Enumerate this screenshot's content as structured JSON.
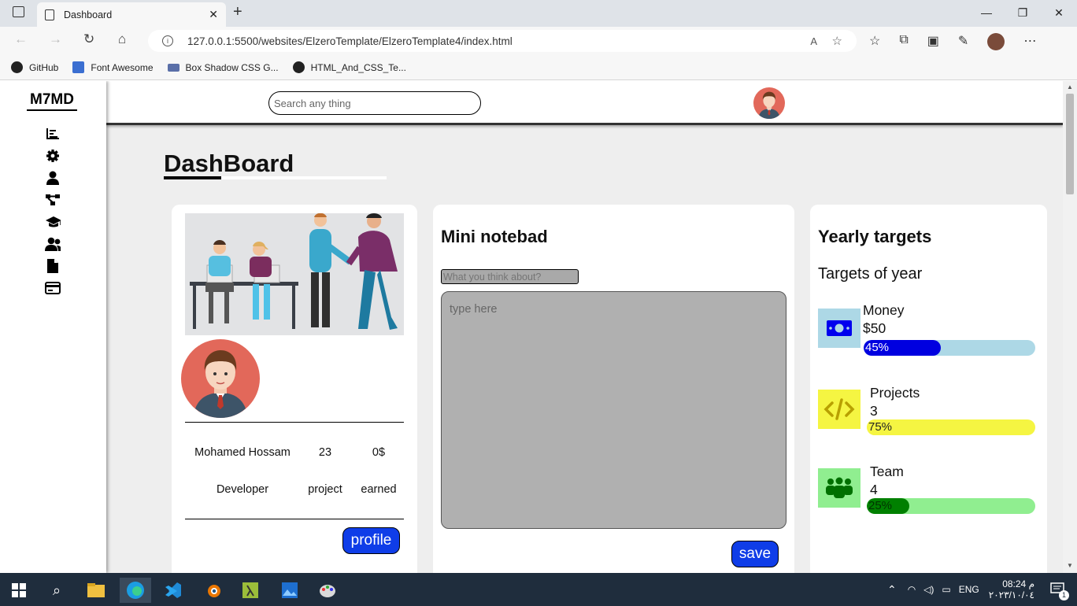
{
  "browser": {
    "tab_title": "Dashboard",
    "url": "127.0.0.1:5500/websites/ElzeroTemplate/ElzeroTemplate4/index.html",
    "bookmarks": [
      {
        "label": "GitHub",
        "color": "#222"
      },
      {
        "label": "Font Awesome",
        "color": "#3b6fd1"
      },
      {
        "label": "Box Shadow CSS G...",
        "color": "#5a6fa8"
      },
      {
        "label": "HTML_And_CSS_Te...",
        "color": "#222"
      }
    ]
  },
  "sidebar": {
    "logo": "M7MD",
    "icons": [
      "chart-icon",
      "gear-icon",
      "user-icon",
      "diagram-icon",
      "graduation-cap-icon",
      "users-icon",
      "file-icon",
      "credit-card-icon"
    ]
  },
  "header": {
    "search_placeholder": "Search any thing"
  },
  "main": {
    "title": "DashBoard"
  },
  "profile_card": {
    "name": "Mohamed Hossam",
    "role": "Developer",
    "projects_count": "23",
    "projects_label": "project",
    "earned_value": "0$",
    "earned_label": "earned",
    "button": "profile"
  },
  "notepad": {
    "title": "Mini notebad",
    "input_placeholder": "What you think about?",
    "textarea_placeholder": "type here",
    "button": "save"
  },
  "targets": {
    "title": "Yearly targets",
    "subtitle": "Targets of year",
    "items": [
      {
        "name": "Money",
        "value": "$50",
        "percent_label": "45%",
        "percent": 45,
        "icon": "money-icon",
        "icon_bg": "#add8e6",
        "icon_color": "#0000ee",
        "track": "#add8e6",
        "fill": "#0000e0",
        "text": "#ffffff"
      },
      {
        "name": "Projects",
        "value": "3",
        "percent_label": "75%",
        "percent": 75,
        "icon": "code-icon",
        "icon_bg": "#f5f542",
        "icon_color": "#b8a000",
        "track": "#f5f542",
        "fill": "#f5f542",
        "text": "#222222"
      },
      {
        "name": "Team",
        "value": "4",
        "percent_label": "25%",
        "percent": 25,
        "icon": "team-icon",
        "icon_bg": "#90ee90",
        "icon_color": "#007000",
        "track": "#90ee90",
        "fill": "#008000",
        "text": "#003300"
      }
    ]
  },
  "system": {
    "language": "ENG",
    "time": "08:24 م",
    "date": "٢٠٢٣/١٠/٠٤",
    "notifications": "1"
  }
}
